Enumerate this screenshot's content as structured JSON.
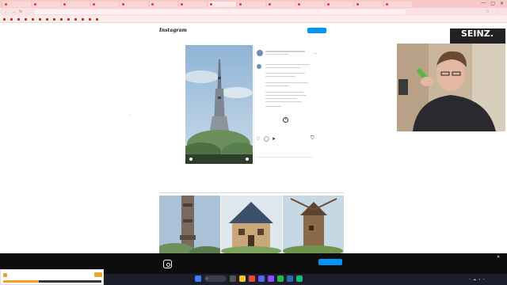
{
  "browser": {
    "tabs": [
      "",
      "",
      "",
      "",
      "",
      "",
      "",
      "",
      "",
      "",
      "",
      "",
      "",
      "",
      "",
      ""
    ],
    "window_controls": [
      "—",
      "▢",
      "✕"
    ],
    "address": "",
    "address_icons": [
      "☆",
      "⋮"
    ],
    "bookmarks": [
      "",
      "",
      "",
      "",
      "",
      "",
      "",
      "",
      "",
      "",
      "",
      "",
      "",
      "",
      "",
      "",
      ""
    ]
  },
  "instagram": {
    "logo": "Instagram",
    "login_label": "",
    "signup_label": "",
    "post": {
      "more_label": "···",
      "plus_label": "+",
      "actions": [
        "♡",
        "◯",
        "➤",
        "⛉"
      ],
      "likes": "",
      "date": ""
    },
    "more_posts_title": ""
  },
  "webcam": {
    "logo": "SEINZ.",
    "sub": ""
  },
  "cookie_banner": {
    "title": "",
    "text": "",
    "accept": "",
    "decline": "",
    "close": "✕"
  },
  "taskbar": {
    "search": "",
    "time": "",
    "date": "",
    "tray": [
      "^",
      "☁",
      "◖",
      "⌁"
    ]
  },
  "widget": {
    "title": "",
    "progress": 0.36,
    "accent": "#f2a21b"
  },
  "colors": {
    "instagram_blue": "#0095f6",
    "chrome_pink": "#f6c8c8",
    "taskbar": "#1c1f2b"
  }
}
